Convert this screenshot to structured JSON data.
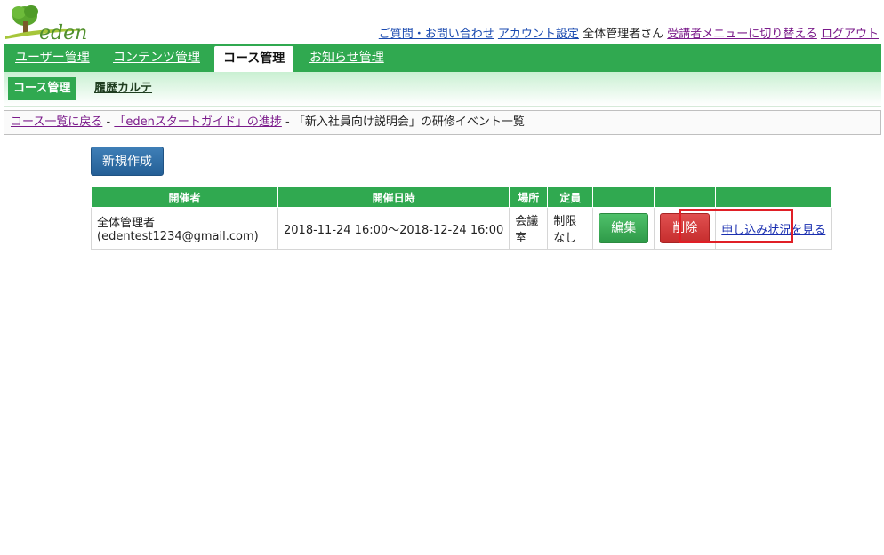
{
  "brand": {
    "logo_text": "eden"
  },
  "header": {
    "links": {
      "contact": "ご質問・お問い合わせ",
      "account": "アカウント設定",
      "user": "全体管理者さん",
      "switch_menu": "受講者メニューに切り替える",
      "logout": "ログアウト"
    }
  },
  "main_nav": {
    "tabs": [
      {
        "label": "ユーザー管理"
      },
      {
        "label": "コンテンツ管理"
      },
      {
        "label": "コース管理",
        "active": true
      },
      {
        "label": "お知らせ管理"
      }
    ]
  },
  "sub_nav": {
    "active": "コース管理",
    "link": "履歴カルテ"
  },
  "breadcrumb": {
    "items": [
      "コース一覧に戻る",
      "「edenスタートガイド」の進捗"
    ],
    "separator": "-",
    "current": "「新入社員向け説明会」の研修イベント一覧"
  },
  "actions": {
    "new_label": "新規作成"
  },
  "events_table": {
    "columns": [
      "開催者",
      "開催日時",
      "場所",
      "定員",
      "",
      "",
      ""
    ],
    "rows": [
      {
        "organizer_name": "全体管理者",
        "organizer_email": "(edentest1234@gmail.com)",
        "datetime": "2018-11-24 16:00〜2018-12-24 16:00",
        "place": "会議室",
        "capacity": "制限なし",
        "edit_label": "編集",
        "delete_label": "削除",
        "status_label": "申し込み状況を見る"
      }
    ]
  },
  "colors": {
    "nav_green": "#30a950",
    "new_button_blue": "#2e6da4",
    "edit_green": "#3aae56",
    "delete_red": "#d33b3b",
    "highlight_red": "#e01f26"
  }
}
